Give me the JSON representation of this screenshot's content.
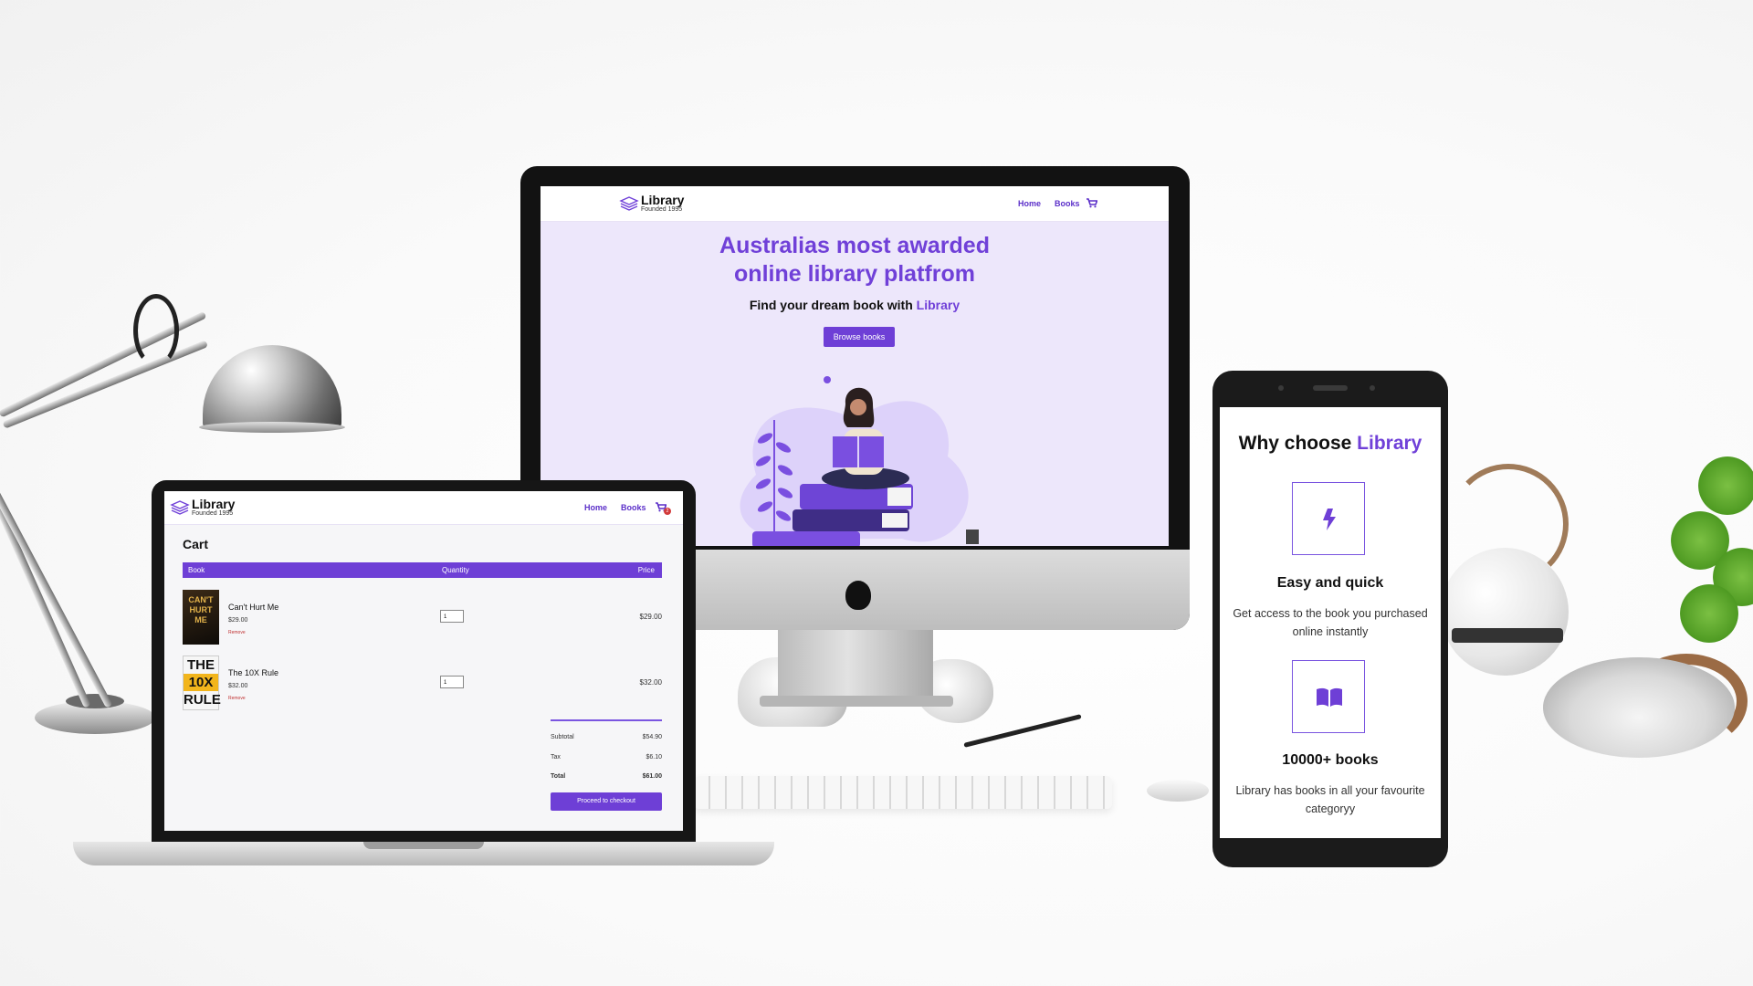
{
  "brand": {
    "name": "Library",
    "tagline": "Founded 1995",
    "accent_color": "#7040d8"
  },
  "desktop": {
    "nav": {
      "home": "Home",
      "books": "Books",
      "cart_icon": "cart-icon"
    },
    "hero": {
      "title_line1": "Australias most awarded",
      "title_line2": "online library platfrom",
      "subtitle_prefix": "Find your dream book with ",
      "subtitle_brand": "Library",
      "cta": "Browse books"
    }
  },
  "laptop": {
    "nav": {
      "home": "Home",
      "books": "Books",
      "cart_icon": "cart-icon"
    },
    "cart": {
      "title": "Cart",
      "columns": [
        "Book",
        "Quantity",
        "Price"
      ],
      "items": [
        {
          "title": "Can't Hurt Me",
          "price": "$29.00",
          "remove": "Remove",
          "quantity": "1",
          "line_total": "$29.00",
          "cover_text": "CAN'T HURT ME"
        },
        {
          "title": "The 10X Rule",
          "price": "$32.00",
          "remove": "Remove",
          "quantity": "1",
          "line_total": "$32.00",
          "cover_text": [
            "THE",
            "10X",
            "RULE"
          ]
        }
      ],
      "summary": {
        "subtotal_label": "Subtotal",
        "subtotal": "$54.90",
        "tax_label": "Tax",
        "tax": "$6.10",
        "total_label": "Total",
        "total": "$61.00"
      },
      "checkout": "Proceed to checkout",
      "cart_badge": "2"
    }
  },
  "phone": {
    "heading_prefix": "Why choose ",
    "heading_brand": "Library",
    "features": [
      {
        "icon": "lightning-icon",
        "title": "Easy and quick",
        "desc": "Get access to the book you purchased online instantly"
      },
      {
        "icon": "book-icon",
        "title": "10000+ books",
        "desc": "Library has books in all your favourite categoryy"
      }
    ]
  }
}
